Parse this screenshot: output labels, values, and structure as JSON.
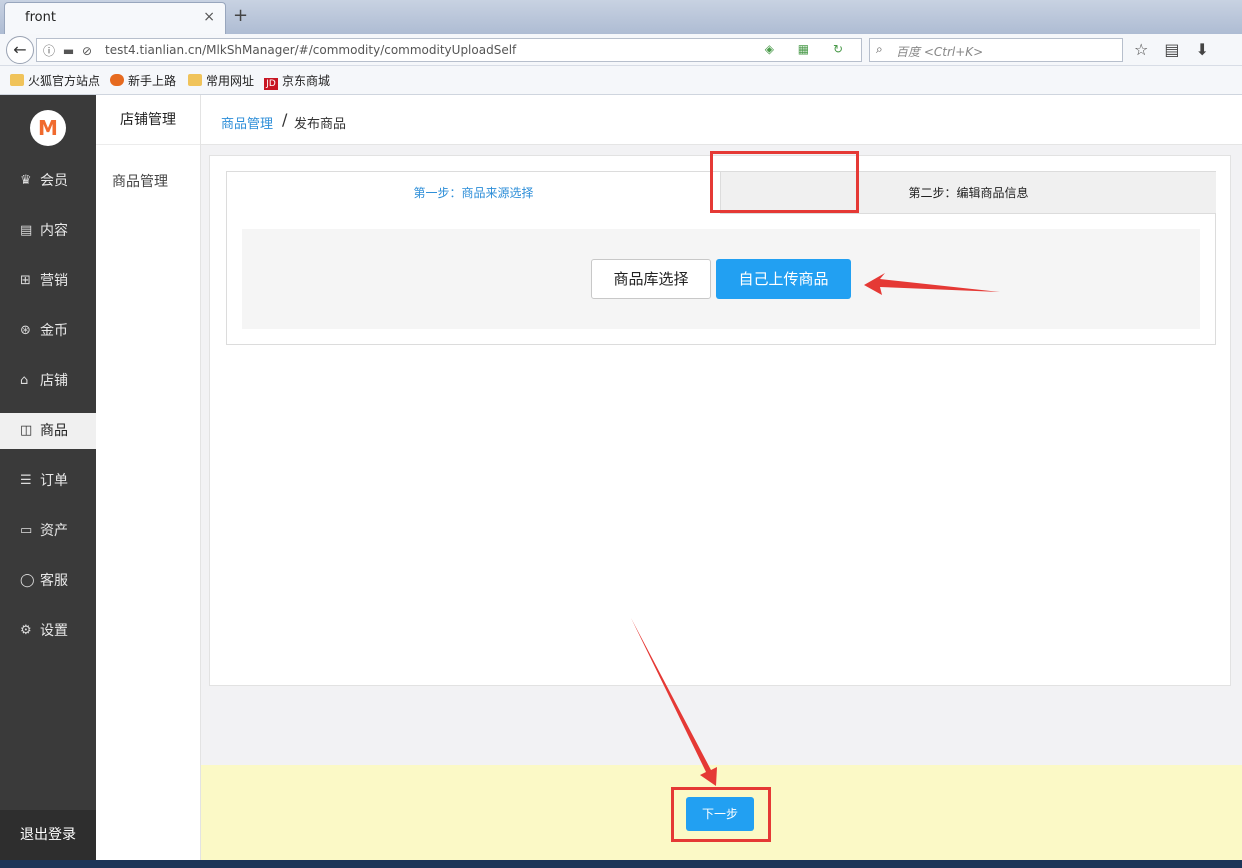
{
  "browser": {
    "tab_title": "front",
    "tab_close": "×",
    "new_tab": "+",
    "back": "←",
    "url": "test4.tianlian.cn/MlkShManager/#/commodity/commodityUploadSelf",
    "search_placeholder": "百度 <Ctrl+K>",
    "bookmarks": [
      "火狐官方站点",
      "新手上路",
      "常用网址",
      "京东商城"
    ],
    "jd_icon_text": "JD"
  },
  "sidebar": {
    "logo": "M",
    "items": [
      {
        "label": "会员",
        "icon": "crown-icon"
      },
      {
        "label": "内容",
        "icon": "document-icon"
      },
      {
        "label": "营销",
        "icon": "grid-icon"
      },
      {
        "label": "金币",
        "icon": "coin-icon"
      },
      {
        "label": "店铺",
        "icon": "store-icon"
      },
      {
        "label": "商品",
        "icon": "bag-icon",
        "active": true
      },
      {
        "label": "订单",
        "icon": "clipboard-icon"
      },
      {
        "label": "资产",
        "icon": "wallet-icon"
      },
      {
        "label": "客服",
        "icon": "chat-icon"
      },
      {
        "label": "设置",
        "icon": "gear-icon"
      }
    ],
    "logout": "退出登录"
  },
  "submenu": {
    "header": "店铺管理",
    "item": "商品管理"
  },
  "breadcrumb": {
    "link": "商品管理",
    "separator": "/",
    "current": "发布商品"
  },
  "steps": {
    "step1": "第一步：商品来源选择",
    "step2": "第二步：编辑商品信息"
  },
  "source": {
    "library_button": "商品库选择",
    "self_upload_button": "自己上传商品"
  },
  "footer": {
    "next_button": "下一步"
  },
  "colors": {
    "accent": "#22a0f2",
    "annotation": "#e53935",
    "sidebar_bg": "#3a3a3a",
    "footer_bg": "#fbf9c6"
  }
}
